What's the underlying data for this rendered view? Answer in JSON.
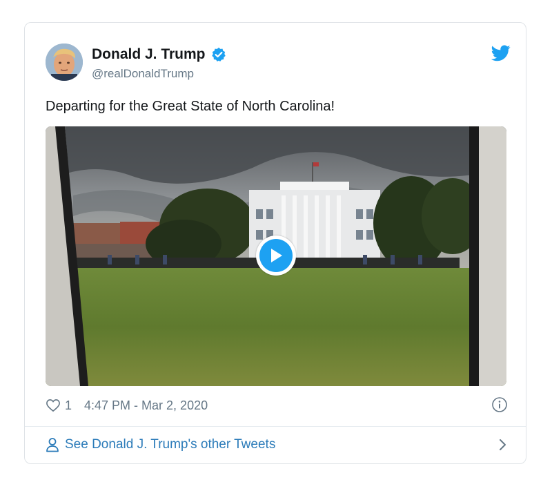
{
  "tweet": {
    "display_name": "Donald J. Trump",
    "handle": "@realDonaldTrump",
    "text": "Departing for the Great State of North Carolina!",
    "like_count": "1",
    "timestamp": "4:47 PM - Mar 2, 2020",
    "verified": true
  },
  "footer": {
    "see_more_label": "See Donald J. Trump's other Tweets"
  },
  "icons": {
    "brand": "twitter-bird-icon",
    "verified": "verified-badge-icon",
    "like": "heart-icon",
    "info": "info-icon",
    "profile": "person-icon",
    "chevron": "chevron-right-icon",
    "play": "play-icon"
  },
  "colors": {
    "accent": "#1da1f2",
    "link": "#2b7bb9",
    "text_primary": "#14171a",
    "text_secondary": "#657786",
    "border": "#dfe3e7"
  }
}
